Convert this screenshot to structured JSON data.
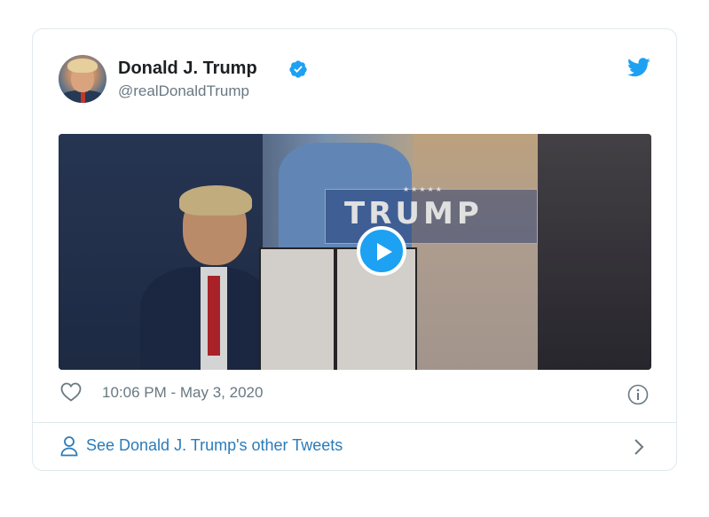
{
  "tweet": {
    "author_name": "Donald J. Trump",
    "handle": "@realDonaldTrump",
    "timestamp": "10:06 PM - May 3, 2020",
    "media": {
      "banner_text": "TRUMP",
      "banner_stars": "★★★★★"
    },
    "footer_link": "See Donald J. Trump's other Tweets"
  },
  "icons": {
    "verified": "verified-badge-icon",
    "brand": "twitter-bird-icon",
    "play": "play-icon",
    "like": "heart-icon",
    "info": "info-icon",
    "person": "person-icon",
    "chevron": "chevron-right-icon"
  },
  "colors": {
    "accent": "#1da1f2",
    "link": "#2b7bb9",
    "muted": "#697882",
    "text": "#1c2022",
    "border": "#e1e8ed"
  }
}
